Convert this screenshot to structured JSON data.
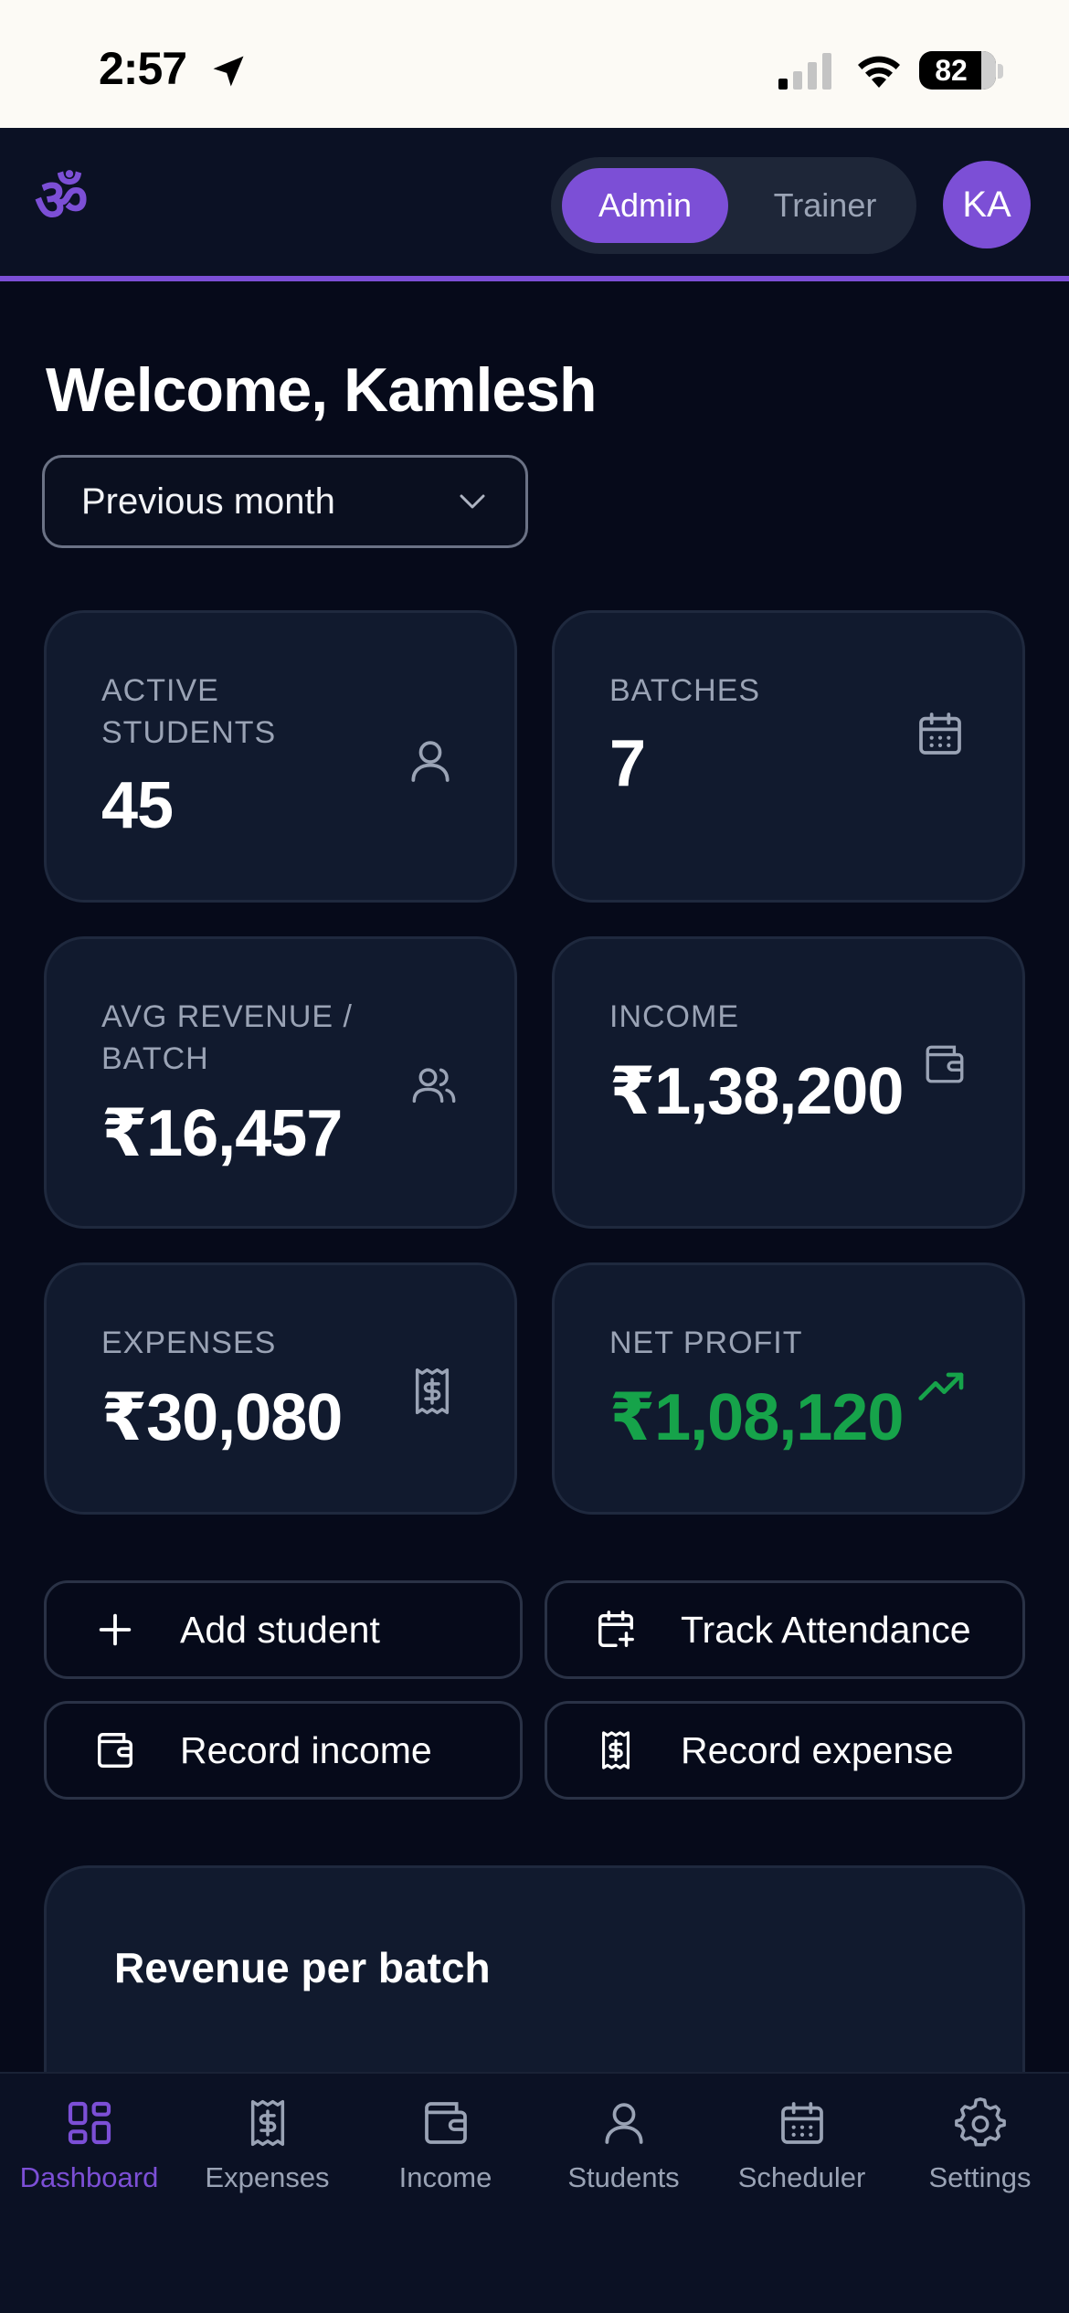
{
  "status_bar": {
    "time": "2:57",
    "battery": "82"
  },
  "header": {
    "logo": "ॐ",
    "roles": [
      "Admin",
      "Trainer"
    ],
    "active_role": "Admin",
    "avatar_initials": "KA"
  },
  "welcome": "Welcome, Kamlesh",
  "period": {
    "selected": "Previous month"
  },
  "stats": [
    {
      "label": "ACTIVE STUDENTS",
      "value": "45",
      "icon": "user-icon"
    },
    {
      "label": "BATCHES",
      "value": "7",
      "icon": "calendar-icon"
    },
    {
      "label": "AVG REVENUE / BATCH",
      "value": "₹16,457",
      "icon": "users-icon"
    },
    {
      "label": "INCOME",
      "value": "₹1,38,200",
      "icon": "wallet-icon"
    },
    {
      "label": "EXPENSES",
      "value": "₹30,080",
      "icon": "receipt-icon"
    },
    {
      "label": "NET PROFIT",
      "value": "₹1,08,120",
      "icon": "trending-up-icon"
    }
  ],
  "actions": [
    {
      "label": "Add student",
      "icon": "plus-icon"
    },
    {
      "label": "Track Attendance",
      "icon": "calendar-plus-icon"
    },
    {
      "label": "Record income",
      "icon": "wallet-icon"
    },
    {
      "label": "Record expense",
      "icon": "receipt-icon"
    }
  ],
  "revenue": {
    "title": "Revenue per batch"
  },
  "nav": [
    {
      "label": "Dashboard",
      "icon": "dashboard-icon",
      "active": true
    },
    {
      "label": "Expenses",
      "icon": "receipt-icon"
    },
    {
      "label": "Income",
      "icon": "wallet-icon"
    },
    {
      "label": "Students",
      "icon": "user-icon"
    },
    {
      "label": "Scheduler",
      "icon": "calendar-icon"
    },
    {
      "label": "Settings",
      "icon": "gear-icon"
    }
  ],
  "colors": {
    "accent": "#7c4fd6",
    "profit": "#16a34a",
    "background": "#060a1a",
    "card": "#111a2e"
  }
}
